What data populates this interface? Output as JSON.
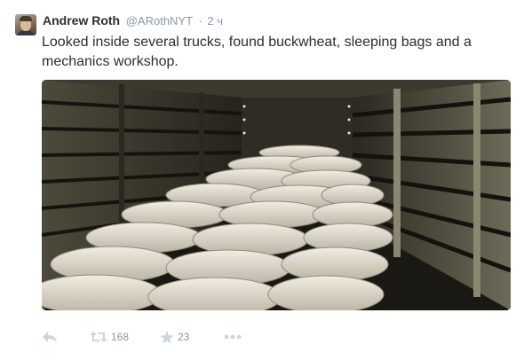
{
  "tweet": {
    "author": {
      "fullname": "Andrew Roth",
      "username": "@ARothNYT"
    },
    "separator": "·",
    "timestamp": "2 ч",
    "text": "Looked inside several trucks, found buckwheat, sleeping bags and a mechanics workshop.",
    "media": {
      "type": "photo"
    },
    "actions": {
      "reply_icon": "reply-icon",
      "retweet_icon": "retweet-icon",
      "retweet_count": "168",
      "favorite_icon": "star-icon",
      "favorite_count": "23",
      "more_icon": "more-dots-icon"
    }
  },
  "colors": {
    "text": "#292f33",
    "secondary": "#8899a6",
    "icon": "#ccd6dd"
  }
}
